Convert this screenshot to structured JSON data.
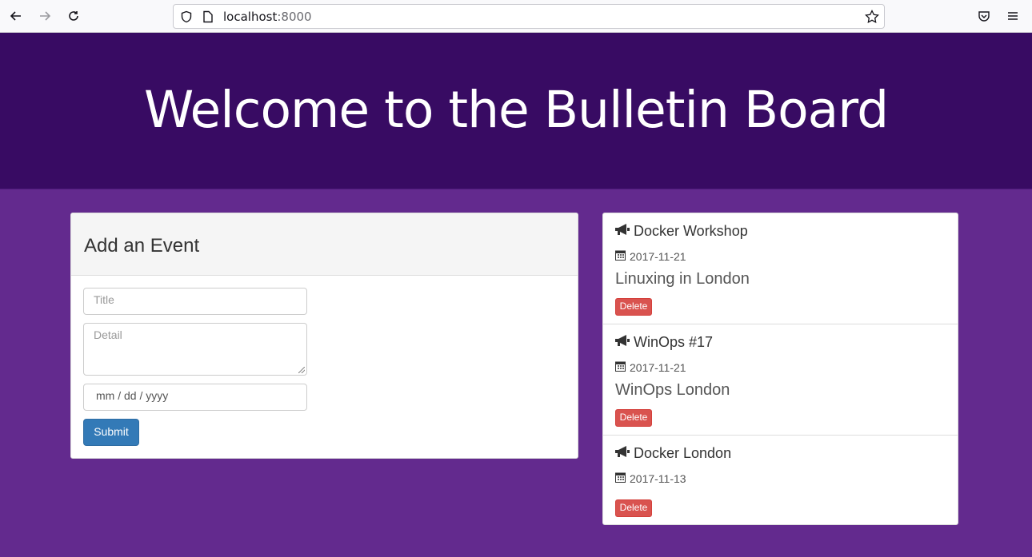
{
  "browser": {
    "url_host": "localhost",
    "url_port": ":8000"
  },
  "header": {
    "title": "Welcome to the Bulletin Board"
  },
  "form": {
    "heading": "Add an Event",
    "title_placeholder": "Title",
    "detail_placeholder": "Detail",
    "date_placeholder": "mm / dd / yyyy",
    "submit_label": "Submit"
  },
  "events": [
    {
      "title": "Docker Workshop",
      "date": "2017-11-21",
      "detail": "Linuxing in London",
      "delete_label": "Delete"
    },
    {
      "title": "WinOps #17",
      "date": "2017-11-21",
      "detail": "WinOps London",
      "delete_label": "Delete"
    },
    {
      "title": "Docker London",
      "date": "2017-11-13",
      "detail": "",
      "delete_label": "Delete"
    }
  ]
}
